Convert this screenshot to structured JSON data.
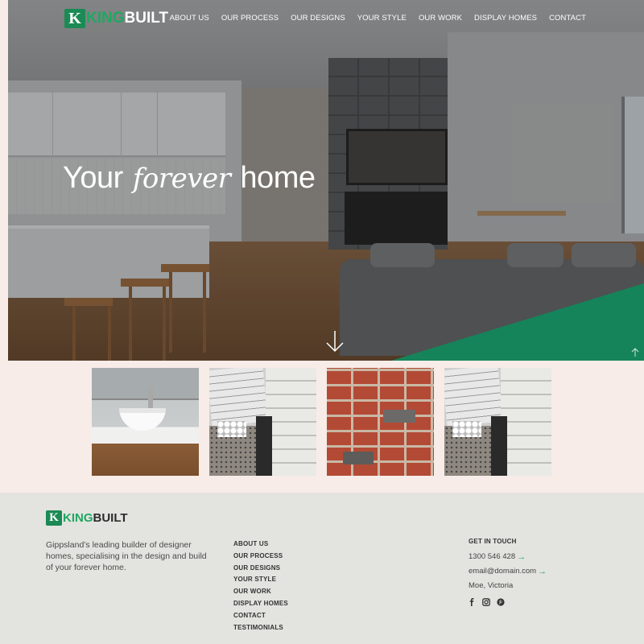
{
  "brand": {
    "badge": "K",
    "name_part1": "KING",
    "name_part2": "BUILT",
    "accent": "#1fa862"
  },
  "nav": {
    "items": [
      "ABOUT US",
      "OUR PROCESS",
      "OUR DESIGNS",
      "YOUR STYLE",
      "OUR WORK",
      "DISPLAY HOMES",
      "CONTACT"
    ]
  },
  "hero": {
    "headline_pre": "Your",
    "headline_script": "forever",
    "headline_post": "home",
    "scroll_icon": "down-arrow-icon",
    "back_to_top_icon": "up-arrow-icon"
  },
  "thumbnails": [
    {
      "icon": "bathroom-vanity-photo"
    },
    {
      "icon": "floor-plan-materials-photo"
    },
    {
      "icon": "brick-wall-photo"
    },
    {
      "icon": "floor-plan-materials-photo"
    }
  ],
  "footer": {
    "description": "Gippsland’s leading builder of designer homes, specialising in the design and build of your forever home.",
    "links": [
      "ABOUT US",
      "OUR PROCESS",
      "OUR DESIGNS",
      "YOUR STYLE",
      "OUR WORK",
      "DISPLAY HOMES",
      "CONTACT",
      "TESTIMONIALS"
    ],
    "contact": {
      "heading": "GET IN TOUCH",
      "phone": "1300 546 428",
      "email": "email@domain.com",
      "location": "Moe, Victoria"
    },
    "social": [
      "facebook-icon",
      "instagram-icon",
      "pinterest-icon"
    ]
  }
}
